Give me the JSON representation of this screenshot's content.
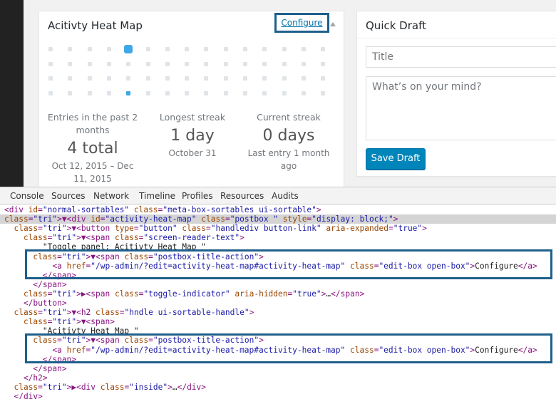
{
  "heatmap": {
    "title": "Acitivty Heat Map",
    "configure": "Configure",
    "grid": {
      "cols": 15,
      "rows": 4,
      "big_cell": [
        4,
        0
      ],
      "active_cell": [
        4,
        3
      ]
    },
    "stats": [
      {
        "label": "Entries in the past 2 months",
        "value": "4 total",
        "sub": "Oct 12, 2015 – Dec 11, 2015"
      },
      {
        "label": "Longest streak",
        "value": "1 day",
        "sub": "October 31"
      },
      {
        "label": "Current streak",
        "value": "0 days",
        "sub": "Last entry 1 month ago"
      }
    ]
  },
  "draft": {
    "title": "Quick Draft",
    "title_placeholder": "Title",
    "content_placeholder": "What’s on your mind?",
    "save": "Save Draft"
  },
  "devtools": {
    "tabs": [
      "Console",
      "Sources",
      "Network",
      "Timeline",
      "Profiles",
      "Resources",
      "Audits"
    ],
    "lines": [
      "<div id=\"normal-sortables\" class=\"meta-box-sortables ui-sortable\">",
      "▼<div id=\"activity-heat-map\" class=\"postbox \" style=\"display: block;\">",
      "  ▼<button type=\"button\" class=\"handlediv button-link\" aria-expanded=\"true\">",
      "    ▼<span class=\"screen-reader-text\">",
      "        \"Toggle panel: Acitivty Heat Map \"",
      "      ▼<span class=\"postbox-title-action\">",
      "          <a href=\"/wp-admin/?edit=activity-heat-map#activity-heat-map\" class=\"edit-box open-box\">Configure</a>",
      "        </span>",
      "      </span>",
      "    ▶<span class=\"toggle-indicator\" aria-hidden=\"true\">…</span>",
      "    </button>",
      "  ▼<h2 class=\"hndle ui-sortable-handle\">",
      "    ▼<span>",
      "        \"Acitivty Heat Map \"",
      "      ▼<span class=\"postbox-title-action\">",
      "          <a href=\"/wp-admin/?edit=activity-heat-map#activity-heat-map\" class=\"edit-box open-box\">Configure</a>",
      "        </span>",
      "      </span>",
      "    </h2>",
      "  ▶<div class=\"inside\">…</div>",
      "  </div>"
    ],
    "selected_line": 1
  }
}
